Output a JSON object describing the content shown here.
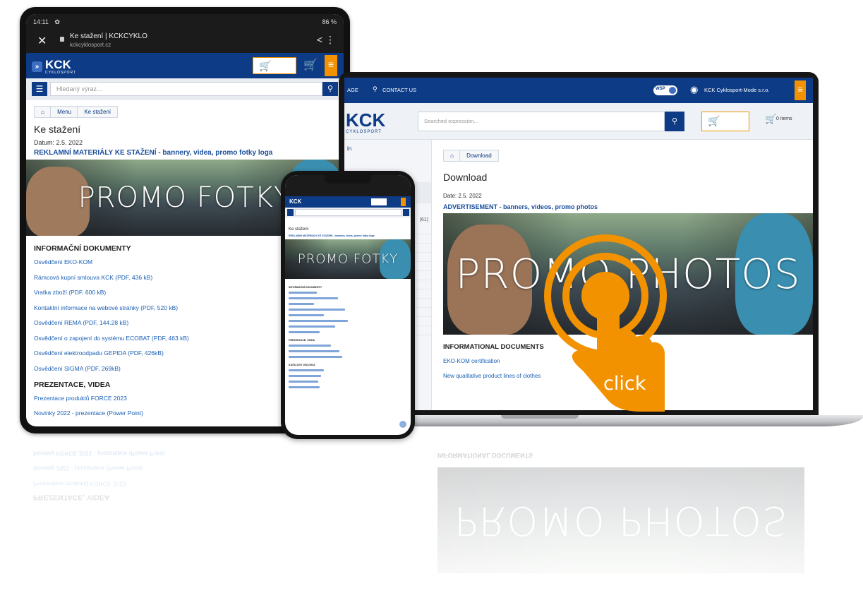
{
  "tablet": {
    "status": {
      "time": "14:11",
      "battery": "86 %"
    },
    "browser": {
      "title": "Ke stažení | KCKCYKLO",
      "url": "kckcyklosport.cz"
    },
    "logo": "KCK",
    "logo_sub": "CYKLOSPORT",
    "search_placeholder": "Hledaný výraz...",
    "breadcrumb": [
      "Menu",
      "Ke stažení"
    ],
    "page_title": "Ke stažení",
    "date": "Datum: 2.5. 2022",
    "headline": "REKLAMNÍ MATERIÁLY KE STAŽENÍ - bannery, videa, promo fotky loga",
    "promo_text": "PROMO FOTKY",
    "section_docs": "INFORMAČNÍ DOKUMENTY",
    "docs": [
      "Osvědčení EKO-KOM",
      "Rámcová kupní smlouva KCK (PDF, 436 kB)",
      "Vratka zboží (PDF, 600 kB)",
      "Kontaktní informace na webové stránky (PDF, 520 kB)",
      "Osvědčení REMA (PDF, 144.28 kB)",
      "Osvědčení o zapojení do systému ECOBAT (PDF, 463 kB)",
      "Osvědčení elektroodpadu GEPIDA (PDF, 426kB)",
      "Osvědčení SIGMA (PDF, 269kB)"
    ],
    "section_video": "PREZENTACE, VIDEA",
    "videos": [
      "Prezentace produktů FORCE 2023",
      "Novinky 2022 - prezentace (Power Point)",
      "Novinky FORCE 2021 - prezentace (Power Point)"
    ]
  },
  "laptop": {
    "top_left": "AGE",
    "contact": "CONTACT US",
    "toggle": "WSP",
    "account": "KCK Cyklosport-Mode s.r.o.",
    "logo": "KCK",
    "logo_sub": "CYKLOSPORT",
    "search_placeholder": "Searched expression...",
    "cart_items": "0 items",
    "breadcrumb": "Download",
    "side_label": "in",
    "side_partial": "(61)",
    "page_title": "Download",
    "date": "Date: 2.5. 2022",
    "headline": "ADVERTISEMENT - banners, videos, promo photos",
    "promo_text": "PROMO PHOTOS",
    "section_docs": "INFORMATIONAL DOCUMENTS",
    "docs": [
      "EKO-KOM certification",
      "New qualitative product lines of clothes"
    ]
  },
  "phone": {
    "logo": "KCK",
    "page_title": "Ke stažení",
    "headline": "REKLAMNÍ MATERIÁLY KE STAŽENÍ - bannery, videa, promo fotky loga",
    "promo_text": "PROMO FOTKY",
    "section_docs": "INFORMAČNÍ DOKUMENTY",
    "section_video": "PREZENTACE, VIDEA",
    "section_catalog": "KATALOGY 2021/2022"
  },
  "overlay": {
    "label": "click"
  },
  "colors": {
    "brand_blue": "#0d3b85",
    "accent_orange": "#f39200",
    "link_blue": "#1a5fb4"
  }
}
